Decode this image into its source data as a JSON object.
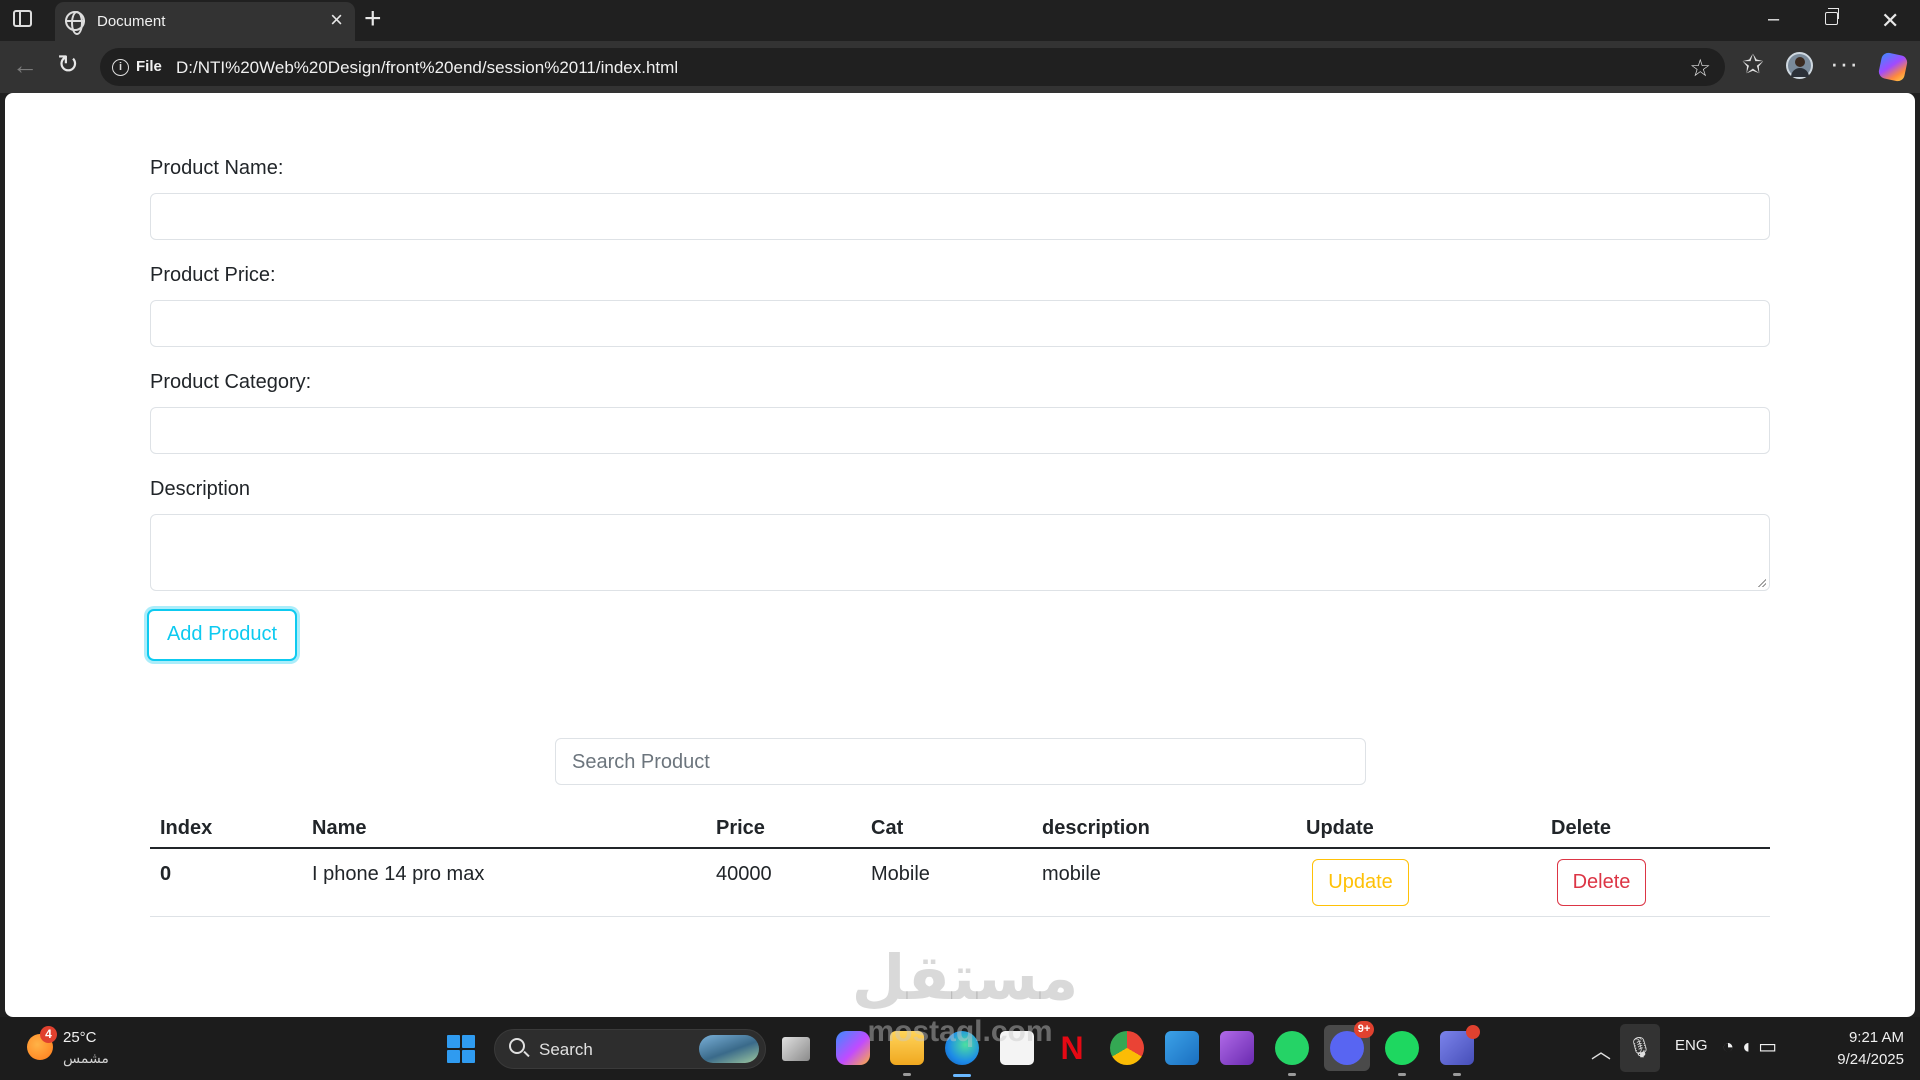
{
  "browser": {
    "tab_title": "Document",
    "tab_close": "×",
    "new_tab": "+",
    "address_prefix": "File",
    "address_url": "D:/NTI%20Web%20Design/front%20end/session%2011/index.html",
    "window_controls": {
      "minimize": "–",
      "close": "✕"
    },
    "more_menu": "···"
  },
  "form": {
    "name_label": "Product Name:",
    "price_label": "Product Price:",
    "category_label": "Product Category:",
    "description_label": "Description",
    "submit_label": "Add Product"
  },
  "search": {
    "placeholder": "Search Product"
  },
  "table": {
    "headers": [
      "Index",
      "Name",
      "Price",
      "Cat",
      "description",
      "Update",
      "Delete"
    ],
    "rows": [
      {
        "index": "0",
        "name": "I phone 14 pro max",
        "price": "40000",
        "cat": "Mobile",
        "description": "mobile",
        "update_label": "Update",
        "delete_label": "Delete"
      }
    ]
  },
  "watermark": {
    "text": "مستقل",
    "sub": "mostaql.com"
  },
  "taskbar": {
    "weather_badge": "4",
    "weather_temp": "25°C",
    "weather_condition": "مشمس",
    "search_label": "Search",
    "language": "ENG",
    "time": "9:21 AM",
    "date": "9/24/2025",
    "discord_badge": "9+"
  },
  "colors": {
    "info": "#0dcaf0",
    "warning": "#ffc107",
    "danger": "#dc3545",
    "chrome_dark": "#202020",
    "chrome_toolbar": "#333333"
  },
  "icons": [
    "sidebar-toggle-icon",
    "globe-icon",
    "back-icon",
    "reload-icon",
    "info-icon",
    "star-icon",
    "favorites-icon",
    "profile-avatar",
    "copilot-icon",
    "windows-start-icon",
    "search-icon",
    "task-view-icon",
    "copilot-app-icon",
    "file-explorer-icon",
    "edge-icon",
    "store-icon",
    "netflix-icon",
    "chrome-icon",
    "vscode-icon",
    "visual-studio-icon",
    "whatsapp-icon",
    "discord-icon",
    "spotify-icon",
    "teams-icon"
  ]
}
